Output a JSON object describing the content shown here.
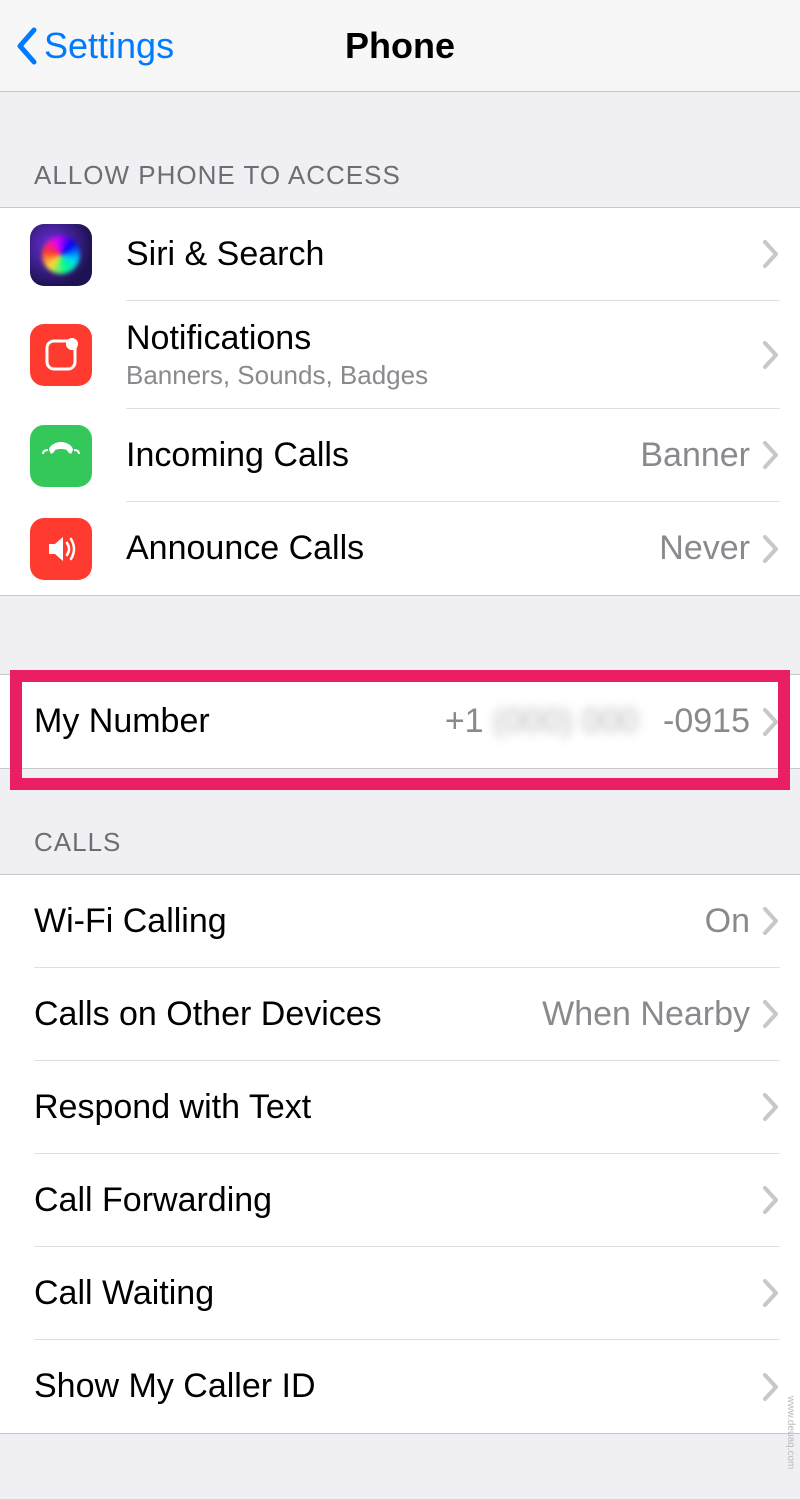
{
  "nav": {
    "back": "Settings",
    "title": "Phone"
  },
  "sections": {
    "access": {
      "header": "ALLOW PHONE TO ACCESS",
      "rows": {
        "siri": {
          "title": "Siri & Search"
        },
        "notifications": {
          "title": "Notifications",
          "subtitle": "Banners, Sounds, Badges"
        },
        "incoming": {
          "title": "Incoming Calls",
          "value": "Banner"
        },
        "announce": {
          "title": "Announce Calls",
          "value": "Never"
        }
      }
    },
    "mynumber": {
      "title": "My Number",
      "value_prefix": "+1",
      "value_suffix": "-0915"
    },
    "calls": {
      "header": "CALLS",
      "rows": {
        "wifi": {
          "title": "Wi-Fi Calling",
          "value": "On"
        },
        "other": {
          "title": "Calls on Other Devices",
          "value": "When Nearby"
        },
        "respond": {
          "title": "Respond with Text"
        },
        "forwarding": {
          "title": "Call Forwarding"
        },
        "waiting": {
          "title": "Call Waiting"
        },
        "callerid": {
          "title": "Show My Caller ID"
        }
      }
    }
  },
  "watermark": "www.deuaq.com"
}
